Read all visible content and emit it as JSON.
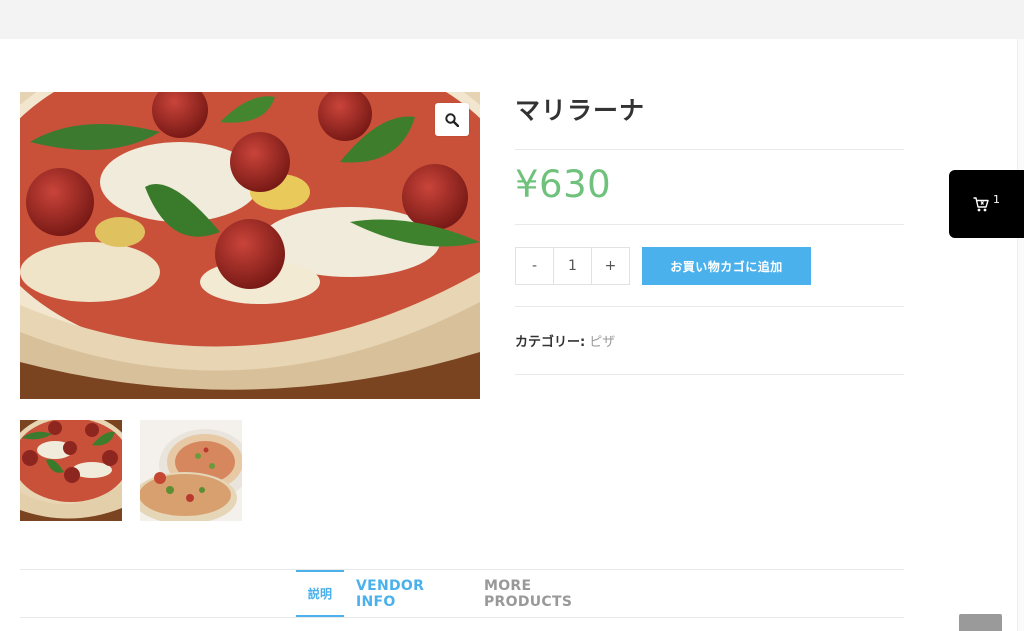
{
  "product": {
    "title": "マリラーナ",
    "price": "¥630",
    "quantity": "1",
    "qty_minus": "-",
    "qty_plus": "+",
    "add_to_cart": "お買い物カゴに追加",
    "category_label": "カテゴリー:",
    "category_value": "ピザ"
  },
  "gallery": {
    "zoom_icon": "magnifier-icon",
    "thumbnails": [
      "pizza-marinara-thumb",
      "pizza-plate-thumb"
    ]
  },
  "floating_cart": {
    "icon": "cart-icon",
    "count": "1"
  },
  "tabs": [
    {
      "label": "説明",
      "active": true
    },
    {
      "label": "VENDOR INFO",
      "active": false
    },
    {
      "label": "MORE PRODUCTS",
      "active": false
    }
  ],
  "colors": {
    "price": "#6fc27b",
    "accent": "#4ab1ec",
    "cart_bg": "#000000"
  }
}
